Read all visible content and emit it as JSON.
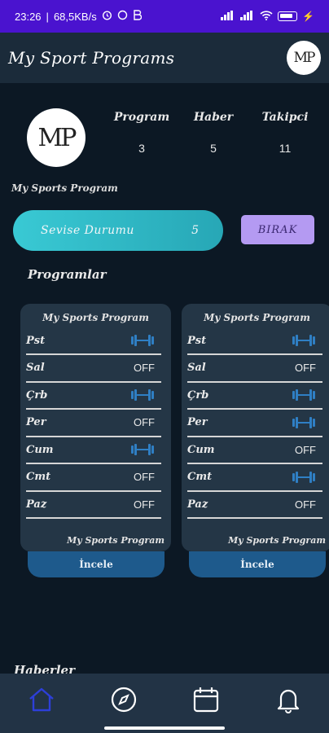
{
  "status_bar": {
    "time": "23:26",
    "network_speed": "68,5KB/s",
    "battery": "85"
  },
  "app_bar": {
    "title": "My Sport Programs",
    "avatar_text": "MP"
  },
  "profile": {
    "avatar_text": "MP",
    "name": "My Sports Program",
    "stats": [
      {
        "label": "Program",
        "value": "3"
      },
      {
        "label": "Haber",
        "value": "5"
      },
      {
        "label": "Takipci",
        "value": "11"
      }
    ]
  },
  "level": {
    "label": "Sevise Durumu",
    "value": "5",
    "quit_label": "BIRAK"
  },
  "programs": {
    "section_title": "Programlar",
    "cards": [
      {
        "title": "My Sports Program",
        "footer": "My Sports Program",
        "button_label": "İncele",
        "days": [
          {
            "name": "Pst",
            "status": "dumbbell"
          },
          {
            "name": "Sal",
            "status": "OFF"
          },
          {
            "name": "Çrb",
            "status": "dumbbell"
          },
          {
            "name": "Per",
            "status": "OFF"
          },
          {
            "name": "Cum",
            "status": "dumbbell"
          },
          {
            "name": "Cmt",
            "status": "OFF"
          },
          {
            "name": "Paz",
            "status": "OFF"
          }
        ]
      },
      {
        "title": "My Sports Program",
        "footer": "My Sports Program",
        "button_label": "İncele",
        "days": [
          {
            "name": "Pst",
            "status": "dumbbell"
          },
          {
            "name": "Sal",
            "status": "OFF"
          },
          {
            "name": "Çrb",
            "status": "dumbbell"
          },
          {
            "name": "Per",
            "status": "dumbbell"
          },
          {
            "name": "Cum",
            "status": "OFF"
          },
          {
            "name": "Cmt",
            "status": "dumbbell"
          },
          {
            "name": "Paz",
            "status": "OFF"
          }
        ]
      }
    ]
  },
  "news": {
    "section_title": "Haberler"
  },
  "bottom_nav": {
    "items": [
      {
        "icon": "home-icon",
        "active": true
      },
      {
        "icon": "compass-icon",
        "active": false
      },
      {
        "icon": "calendar-icon",
        "active": false
      },
      {
        "icon": "bell-icon",
        "active": false
      }
    ]
  },
  "colors": {
    "status_bar": "#4a13cf",
    "background": "#0c1824",
    "app_bar": "#1b2b3a",
    "level_bar": "#39c9d4",
    "quit_button": "#b49af2",
    "card": "#243646",
    "inspect_button": "#1e5a8c",
    "dumbbell": "#2f7fc4",
    "nav_active": "#2d3fd8",
    "nav_inactive": "#ffffff"
  }
}
